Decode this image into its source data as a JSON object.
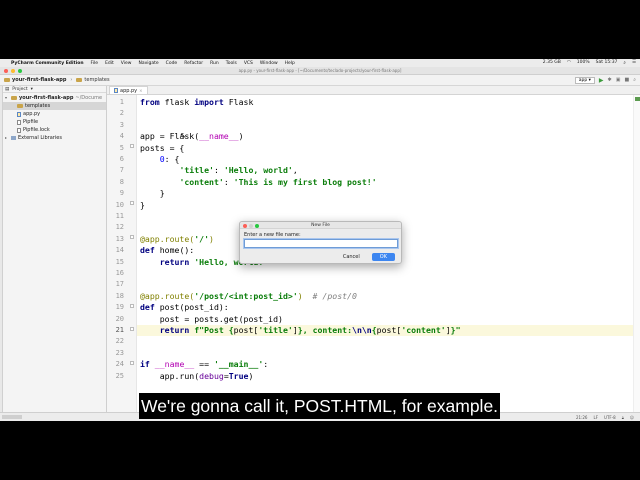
{
  "menubar": {
    "app_name": "PyCharm Community Edition",
    "items": [
      "File",
      "Edit",
      "View",
      "Navigate",
      "Code",
      "Refactor",
      "Run",
      "Tools",
      "VCS",
      "Window",
      "Help"
    ],
    "status_right": [
      "2.35 GB",
      "100%",
      "Sat 15:37"
    ]
  },
  "window_title": "app.py - your-first-flask-app - [~/Documents/teclado-projects/your-first-flask-app]",
  "navbar": {
    "project_crumb": "your-first-flask-app",
    "folder_crumb": "templates",
    "run_config": "app"
  },
  "project_panel": {
    "header": "Project",
    "tree": [
      {
        "label": "your-first-flask-app",
        "path": "~/Docume",
        "type": "folder-root"
      },
      {
        "label": "templates",
        "type": "folder"
      },
      {
        "label": "app.py",
        "type": "py"
      },
      {
        "label": "Pipfile",
        "type": "file"
      },
      {
        "label": "Pipfile.lock",
        "type": "file"
      },
      {
        "label": "External Libraries",
        "type": "lib"
      }
    ]
  },
  "editor": {
    "tab_label": "app.py",
    "current_line": 21,
    "line_numbers": [
      "1",
      "2",
      "3",
      "4",
      "5",
      "6",
      "7",
      "8",
      "9",
      "10",
      "11",
      "12",
      "13",
      "14",
      "15",
      "16",
      "17",
      "18",
      "19",
      "20",
      "21",
      "22",
      "23",
      "24",
      "25"
    ]
  },
  "statusbar": {
    "position": "21:26",
    "line_sep": "LF",
    "encoding": "UTF-8"
  },
  "dialog": {
    "title": "New File",
    "label": "Enter a new file name:",
    "input_value": "",
    "cancel_label": "Cancel",
    "ok_label": "OK"
  },
  "caption": "We're gonna call it, POST.HTML, for example.",
  "colors": {
    "keyword": "#000080",
    "string": "#0a7d0a",
    "current_line": "#fbf8dc",
    "ok_button": "#3d86f0"
  }
}
